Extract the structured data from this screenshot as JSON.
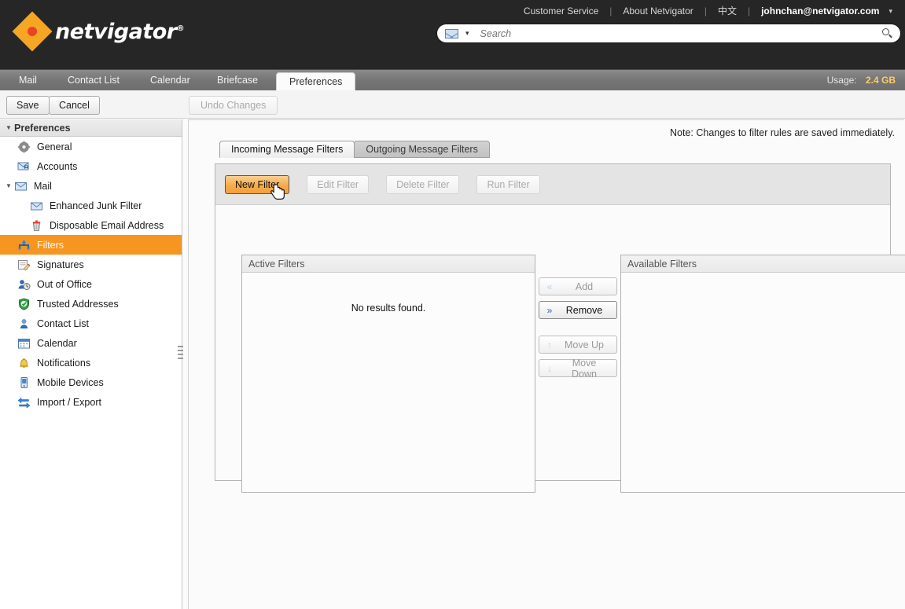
{
  "brand": {
    "logo_text_net": "net",
    "logo_text_vigator": "vigator",
    "registered_mark": "®"
  },
  "topnav": {
    "links": [
      {
        "label": "Customer Service"
      },
      {
        "label": "About Netvigator"
      },
      {
        "label": "中文"
      }
    ],
    "separator": "|",
    "user_email": "johnchan@netvigator.com",
    "caret": "▾"
  },
  "search": {
    "placeholder": "Search",
    "value": "",
    "scope_icon": "mail-icon",
    "dropdown_caret": "▾",
    "submit_icon": "search-icon"
  },
  "apptabs": {
    "items": [
      {
        "label": "Mail",
        "active": false
      },
      {
        "label": "Contact List",
        "active": false
      },
      {
        "label": "Calendar",
        "active": false
      },
      {
        "label": "Briefcase",
        "active": false
      },
      {
        "label": "Preferences",
        "active": true
      }
    ],
    "usage_label": "Usage:",
    "usage_value": "2.4 GB"
  },
  "toolbar": {
    "save_label": "Save",
    "cancel_label": "Cancel",
    "undo_label": "Undo Changes",
    "undo_disabled": true
  },
  "sidebar": {
    "header": "Preferences",
    "header_twisty": "▼",
    "items": [
      {
        "label": "General",
        "icon": "gear-icon",
        "indent": 1,
        "selected": false
      },
      {
        "label": "Accounts",
        "icon": "accounts-icon",
        "indent": 1,
        "selected": false
      },
      {
        "label": "Mail",
        "icon": "mail-icon",
        "indent": 0,
        "selected": false,
        "twisty": "▼"
      },
      {
        "label": "Enhanced Junk Filter",
        "icon": "envelope-icon",
        "indent": 2,
        "selected": false
      },
      {
        "label": "Disposable Email Address",
        "icon": "trash-icon",
        "indent": 2,
        "selected": false
      },
      {
        "label": "Filters",
        "icon": "filter-icon",
        "indent": 1,
        "selected": true
      },
      {
        "label": "Signatures",
        "icon": "signature-icon",
        "indent": 1,
        "selected": false
      },
      {
        "label": "Out of Office",
        "icon": "out-of-office-icon",
        "indent": 1,
        "selected": false
      },
      {
        "label": "Trusted Addresses",
        "icon": "shield-check-icon",
        "indent": 1,
        "selected": false
      },
      {
        "label": "Contact List",
        "icon": "contact-icon",
        "indent": 1,
        "selected": false
      },
      {
        "label": "Calendar",
        "icon": "calendar-icon",
        "indent": 1,
        "selected": false
      },
      {
        "label": "Notifications",
        "icon": "bell-icon",
        "indent": 1,
        "selected": false
      },
      {
        "label": "Mobile Devices",
        "icon": "mobile-icon",
        "indent": 1,
        "selected": false
      },
      {
        "label": "Import / Export",
        "icon": "import-export-icon",
        "indent": 1,
        "selected": false
      }
    ]
  },
  "main": {
    "note": "Note: Changes to filter rules are saved immediately.",
    "subtabs": [
      {
        "label": "Incoming Message Filters",
        "active": true
      },
      {
        "label": "Outgoing Message Filters",
        "active": false
      }
    ],
    "filter_buttons": [
      {
        "label": "New Filter",
        "state": "hover"
      },
      {
        "label": "Edit Filter",
        "state": "disabled"
      },
      {
        "label": "Delete Filter",
        "state": "disabled"
      },
      {
        "label": "Run Filter",
        "state": "disabled"
      }
    ],
    "active_panel": {
      "title": "Active Filters",
      "empty_message": "No results found."
    },
    "available_panel": {
      "title": "Available Filters",
      "empty_message": ""
    },
    "transfer_buttons": [
      {
        "label": "Add",
        "arrow": "«",
        "enabled": false
      },
      {
        "label": "Remove",
        "arrow": "»",
        "enabled": true
      },
      {
        "label": "Move Up",
        "arrow": "↑",
        "enabled": false
      },
      {
        "label": "Move Down",
        "arrow": "↓",
        "enabled": false
      }
    ]
  },
  "colors": {
    "header_black": "#262626",
    "brand_orange": "#f5a623",
    "selected_orange": "#f79521",
    "tabbar_grey": "#757575",
    "usage_amber": "#ffcb6b"
  }
}
